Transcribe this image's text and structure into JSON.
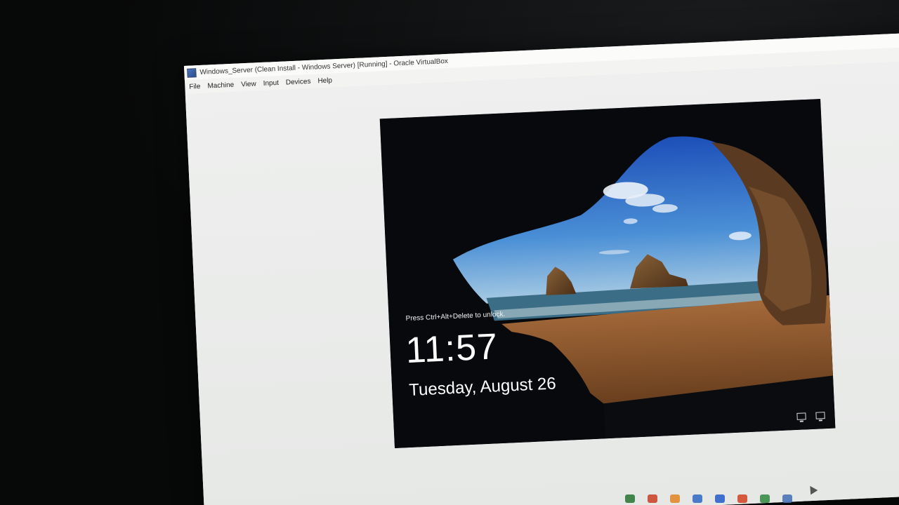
{
  "window": {
    "title": "Windows_Server (Clean Install - Windows Server) [Running] - Oracle VirtualBox",
    "icon": "virtualbox-icon"
  },
  "menu": {
    "items": [
      {
        "label": "File"
      },
      {
        "label": "Machine"
      },
      {
        "label": "View"
      },
      {
        "label": "Input"
      },
      {
        "label": "Devices"
      },
      {
        "label": "Help"
      }
    ]
  },
  "lock_screen": {
    "hint": "Press Ctrl+Alt+Delete to unlock.",
    "time": "11:57",
    "date": "Tuesday, August 26",
    "tray_icons": [
      "display-icon",
      "network-icon"
    ]
  },
  "host_taskbar": {
    "icons": [
      "chrome-icon",
      "app-icon",
      "app-icon",
      "app-icon",
      "app-icon",
      "chrome-icon",
      "chrome-icon",
      "virtualbox-icon"
    ],
    "colors": [
      "#2f7a3a",
      "#c9462d",
      "#e08a2c",
      "#3a6fc4",
      "#2f62c9",
      "#d24a2a",
      "#3a8c46",
      "#4a73b8"
    ]
  }
}
